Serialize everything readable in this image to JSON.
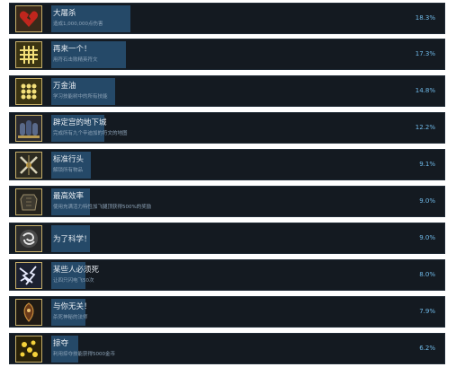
{
  "achievements": [
    {
      "title": "大屠杀",
      "desc": "造成1,000,000点伤害",
      "percent": "18.3%",
      "progress": 0.183,
      "icon": "broken-heart-icon"
    },
    {
      "title": "再来一个！",
      "desc": "用符石击败精英符文",
      "percent": "17.3%",
      "progress": 0.173,
      "icon": "grid-icon"
    },
    {
      "title": "万金油",
      "desc": "学习技能树中的所有技能",
      "percent": "14.8%",
      "progress": 0.148,
      "icon": "dots-grid-icon"
    },
    {
      "title": "辟定宫的地下城",
      "desc": "完成所有九个辛迪加的符文的地图",
      "percent": "12.2%",
      "progress": 0.122,
      "icon": "portal-icon"
    },
    {
      "title": "标准行头",
      "desc": "解锁所有物品",
      "percent": "9.1%",
      "progress": 0.091,
      "icon": "crossed-weapons-icon"
    },
    {
      "title": "最高效率",
      "desc": "使用充满活力特性加飞腿顶获得500%的奖励",
      "percent": "9.0%",
      "progress": 0.09,
      "icon": "armor-icon"
    },
    {
      "title": "为了科学！",
      "desc": "",
      "percent": "9.0%",
      "progress": 0.09,
      "icon": "swirl-icon"
    },
    {
      "title": "某些人必须死",
      "desc": "让四只闪电飞50次",
      "percent": "8.0%",
      "progress": 0.08,
      "icon": "lightning-icon"
    },
    {
      "title": "与你无关！",
      "desc": "杀死神秘的法师",
      "percent": "7.9%",
      "progress": 0.079,
      "icon": "mask-icon"
    },
    {
      "title": "掠夺",
      "desc": "利用掠夺技能获得5000金币",
      "percent": "6.2%",
      "progress": 0.062,
      "icon": "coins-icon"
    }
  ]
}
